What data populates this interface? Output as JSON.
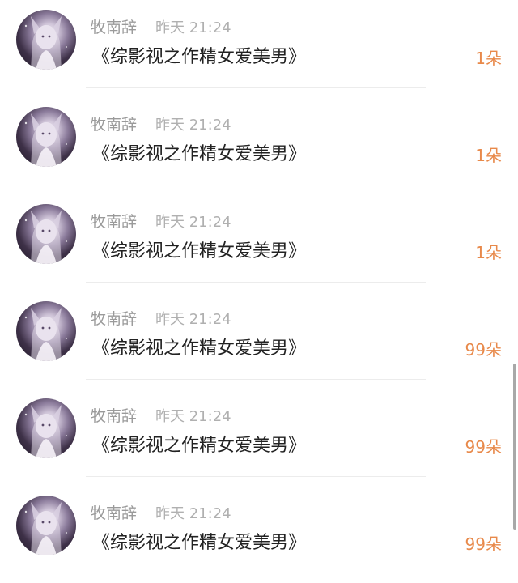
{
  "messages": [
    {
      "name": "牧南辞",
      "time": "昨天 21:24",
      "title": "《综影视之作精女爱美男》",
      "gift": "1朵"
    },
    {
      "name": "牧南辞",
      "time": "昨天 21:24",
      "title": "《综影视之作精女爱美男》",
      "gift": "1朵"
    },
    {
      "name": "牧南辞",
      "time": "昨天 21:24",
      "title": "《综影视之作精女爱美男》",
      "gift": "1朵"
    },
    {
      "name": "牧南辞",
      "time": "昨天 21:24",
      "title": "《综影视之作精女爱美男》",
      "gift": "99朵"
    },
    {
      "name": "牧南辞",
      "time": "昨天 21:24",
      "title": "《综影视之作精女爱美男》",
      "gift": "99朵"
    },
    {
      "name": "牧南辞",
      "time": "昨天 21:24",
      "title": "《综影视之作精女爱美男》",
      "gift": "99朵"
    }
  ],
  "colors": {
    "gift_accent": "#e8894a",
    "name_gray": "#9a9a9a",
    "title_dark": "#222222"
  },
  "icons": {
    "avatar": "anime-character-avatar"
  }
}
